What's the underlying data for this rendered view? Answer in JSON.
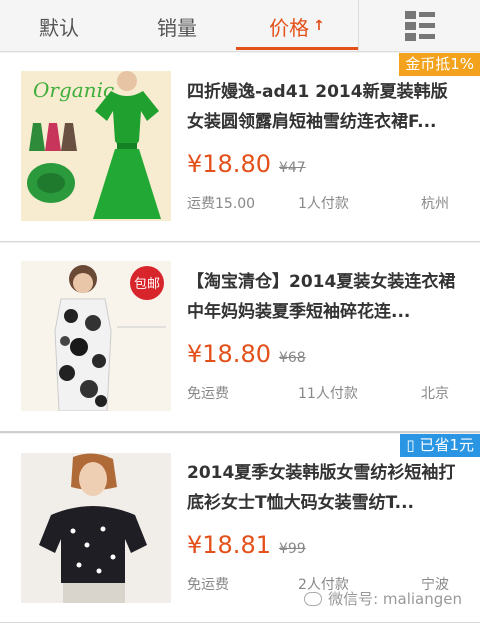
{
  "sort_tabs": [
    {
      "label": "默认"
    },
    {
      "label": "销量"
    },
    {
      "label": "价格",
      "arrow": "↑",
      "active": true
    }
  ],
  "view_toggle_icon": "list-grid-icon",
  "accent_color": "#e4501a",
  "items": [
    {
      "title": "四折嫚逸-ad41 2014新夏装韩版女装圆领露肩短袖雪纺连衣裙F...",
      "price": "¥18.80",
      "original_price": "¥47",
      "shipping": "运费15.00",
      "payers": "1人付款",
      "location": "杭州",
      "badge": "金币抵1%",
      "image_text": "Organic"
    },
    {
      "title": "【淘宝清仓】2014夏装女装连衣裙中年妈妈装夏季短袖碎花连...",
      "price": "¥18.80",
      "original_price": "¥68",
      "shipping": "免运费",
      "payers": "11人付款",
      "location": "北京",
      "image_badge": "包邮"
    },
    {
      "title": "2014夏季女装韩版女雪纺衫短袖打底衫女士T恤大码女装雪纺T...",
      "price": "¥18.81",
      "original_price": "¥99",
      "shipping": "免运费",
      "payers": "2人付款",
      "location": "宁波",
      "badge": "已省1元"
    }
  ],
  "watermark": "微信号: maliangen"
}
